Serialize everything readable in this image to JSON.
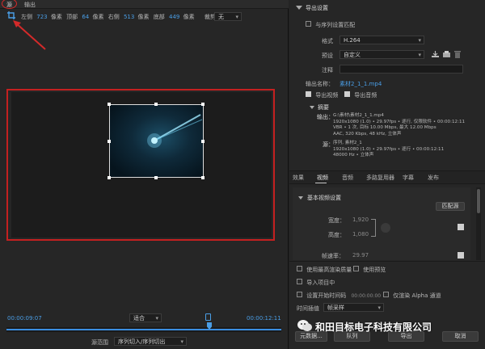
{
  "tabs": {
    "source": "源",
    "output": "输出"
  },
  "crop_bar": {
    "left_label": "左侧",
    "left_value": "723",
    "left_unit": "像素",
    "top_label": "顶部",
    "top_value": "64",
    "top_unit": "像素",
    "right_label": "右侧",
    "right_value": "513",
    "right_unit": "像素",
    "bottom_label": "底部",
    "bottom_value": "449",
    "bottom_unit": "像素",
    "ratio_label": "裁剪比例：",
    "ratio_value": "无"
  },
  "timeline": {
    "current_time": "00:00:09:07",
    "fit_value": "适合",
    "end_time": "00:00:12:11",
    "source_range_label": "源范围",
    "source_range_value": "序列切入/序列切出"
  },
  "export_settings": {
    "header": "导出设置",
    "match_sequence": "与序列设置匹配",
    "format_label": "格式",
    "format_value": "H.264",
    "preset_label": "预设",
    "preset_value": "自定义",
    "comment_label": "注释",
    "output_name_label": "输出名称：",
    "output_name_value": "素材2_1_1.mp4",
    "export_video": "导出视频",
    "export_audio": "导出音频",
    "summary_title": "摘要",
    "output_key": "输出：",
    "output_lines": [
      "G:\\素材\\素材2_1_1.mp4",
      "1920x1080 (1.0) • 29.97fps • 逐行, 仅限软件 • 00:00:12:11",
      "VBR • 1 次, 目标 10.00 Mbps, 最大 12.00 Mbps",
      "AAC, 320 Kbps, 48 kHz, 立体声"
    ],
    "source_key": "源：",
    "source_lines": [
      "序列, 素材2_1",
      "1920x1080 (1.0) • 29.97fps • 逐行 • 00:00:12:11",
      "48000 Hz • 立体声"
    ]
  },
  "settings_tabs": [
    "效果",
    "视频",
    "音频",
    "多路复用器",
    "字幕",
    "发布"
  ],
  "video_settings": {
    "header": "基本视频设置",
    "match_source": "匹配源",
    "width_label": "宽度：",
    "width_value": "1,920",
    "height_label": "高度：",
    "height_value": "1,080",
    "frame_rate_label": "帧速率：",
    "frame_rate_value": "29.97"
  },
  "bottom_options": {
    "max_render": "使用最高渲染质量",
    "use_preview": "使用预览",
    "import_project": "导入项目中",
    "set_start_timecode": "设置开始时间码",
    "start_timecode": "00:00:00:00",
    "render_alpha": "仅渲染 Alpha 通道",
    "interp_label": "时间插值",
    "interp_value": "帧采样"
  },
  "buttons": {
    "metadata": "元数据...",
    "queue": "队列",
    "export": "导出",
    "cancel": "取消"
  },
  "watermark": "和田目标电子科技有限公司"
}
